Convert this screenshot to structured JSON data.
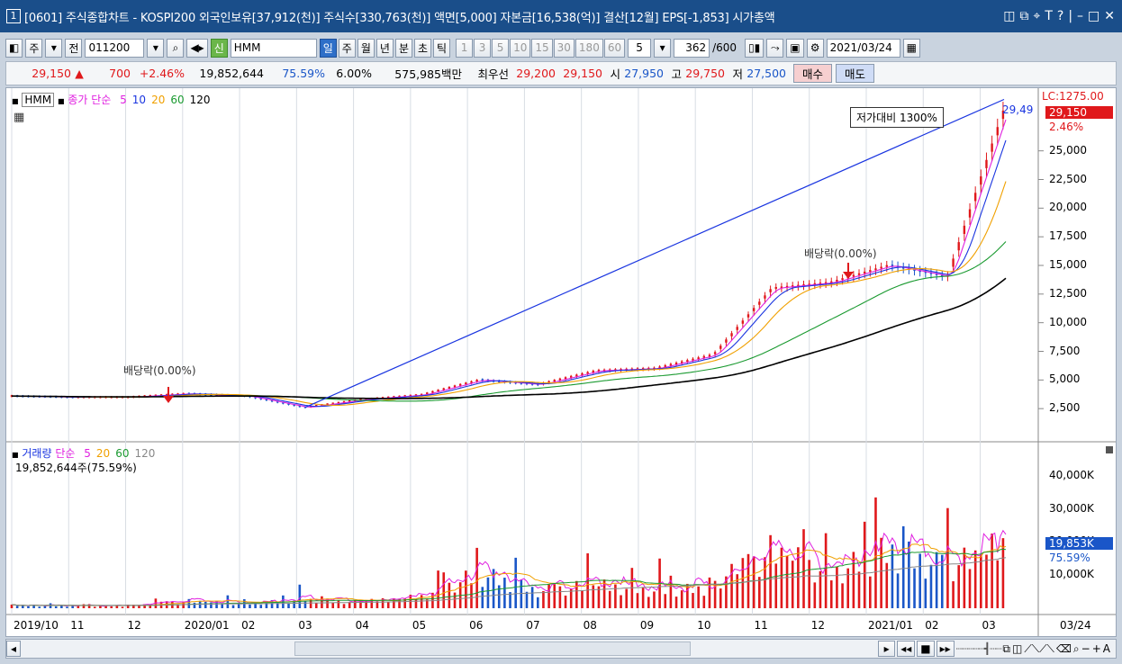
{
  "window": {
    "number": "1",
    "title": "[0601] 주식종합차트 - KOSPI200 외국인보유[37,912(천)] 주식수[330,763(천)] 액면[5,000] 자본금[16,538(억)] 결산[12월] EPS[-1,853] 시가총액",
    "icons": [
      "layout-icon",
      "copy-icon",
      "pin-icon",
      "font-icon",
      "help-icon",
      "minimize-icon",
      "maximize-icon",
      "close-icon"
    ]
  },
  "toolbar": {
    "jong_label": "주",
    "jeon_label": "전",
    "code": "011200",
    "market_badge": "신",
    "name": "HMM",
    "periods": [
      "일",
      "주",
      "월",
      "년",
      "분",
      "초",
      "틱"
    ],
    "selected_period": "일",
    "intervals": [
      "1",
      "3",
      "5",
      "10",
      "15",
      "30",
      "180",
      "60"
    ],
    "interval_value": "5",
    "count": "362",
    "count_total": "/600",
    "date": "2021/03/24"
  },
  "quote": {
    "price": "29,150",
    "arrow": "▲",
    "change": "700",
    "change_pct": "+2.46%",
    "volume": "19,852,644",
    "vol_ratio": "75.59%",
    "rate": "6.00%",
    "amount": "575,985백만",
    "best_label": "최우선",
    "ask": "29,200",
    "bid": "29,150",
    "open_label": "시",
    "open": "27,950",
    "high_label": "고",
    "high": "29,750",
    "low_label": "저",
    "low": "27,500",
    "buy_label": "매수",
    "sell_label": "매도"
  },
  "price_panel": {
    "name": "HMM",
    "legend_prefix": "종가 단순",
    "ma": [
      "5",
      "10",
      "20",
      "60",
      "120"
    ],
    "ma_colors": [
      "#e020e0",
      "#1a35e0",
      "#f0a000",
      "#1a9a30",
      "#000000"
    ],
    "lc_label": "LC:1275.00",
    "last_price": "29,150",
    "last_pct": "2.46%",
    "line_end_label": "29,49",
    "box_label": "저가대비 1300%",
    "dividend_label": "배당락(0.00%)",
    "price_axis": [
      "25,000",
      "22,500",
      "20,000",
      "17,500",
      "15,000",
      "12,500",
      "10,000",
      "7,500",
      "5,000",
      "2,500"
    ]
  },
  "volume_panel": {
    "label": "거래량",
    "legend_prefix": "단순",
    "ma": [
      "5",
      "20",
      "60",
      "120"
    ],
    "summary": "19,852,644주(75.59%)",
    "last_value": "19,853K",
    "last_pct": "75.59%",
    "vol_axis": [
      "40,000K",
      "30,000K",
      "20,000K",
      "10,000K"
    ]
  },
  "xaxis": [
    "2019/10",
    "11",
    "12",
    "2020/01",
    "02",
    "03",
    "04",
    "05",
    "06",
    "07",
    "08",
    "09",
    "10",
    "11",
    "12",
    "2021/01",
    "02",
    "03"
  ],
  "xaxis_right": "03/24",
  "chart_data": {
    "type": "candlestick",
    "x_months": [
      "2019/10",
      "2019/11",
      "2019/12",
      "2020/01",
      "2020/02",
      "2020/03",
      "2020/04",
      "2020/05",
      "2020/06",
      "2020/07",
      "2020/08",
      "2020/09",
      "2020/10",
      "2020/11",
      "2020/12",
      "2021/01",
      "2021/02",
      "2021/03"
    ],
    "close_approx": [
      3600,
      3500,
      3500,
      3800,
      3600,
      2600,
      3300,
      3700,
      5000,
      4600,
      5800,
      6000,
      7200,
      13000,
      13500,
      15000,
      14000,
      29150
    ],
    "volume_k_approx": [
      900,
      800,
      800,
      2500,
      1500,
      3000,
      2000,
      4000,
      12000,
      6000,
      8000,
      6000,
      7000,
      20000,
      12000,
      20000,
      14000,
      22000
    ],
    "ylim": [
      0,
      30000
    ],
    "vol_ylim": [
      0,
      47000
    ]
  }
}
